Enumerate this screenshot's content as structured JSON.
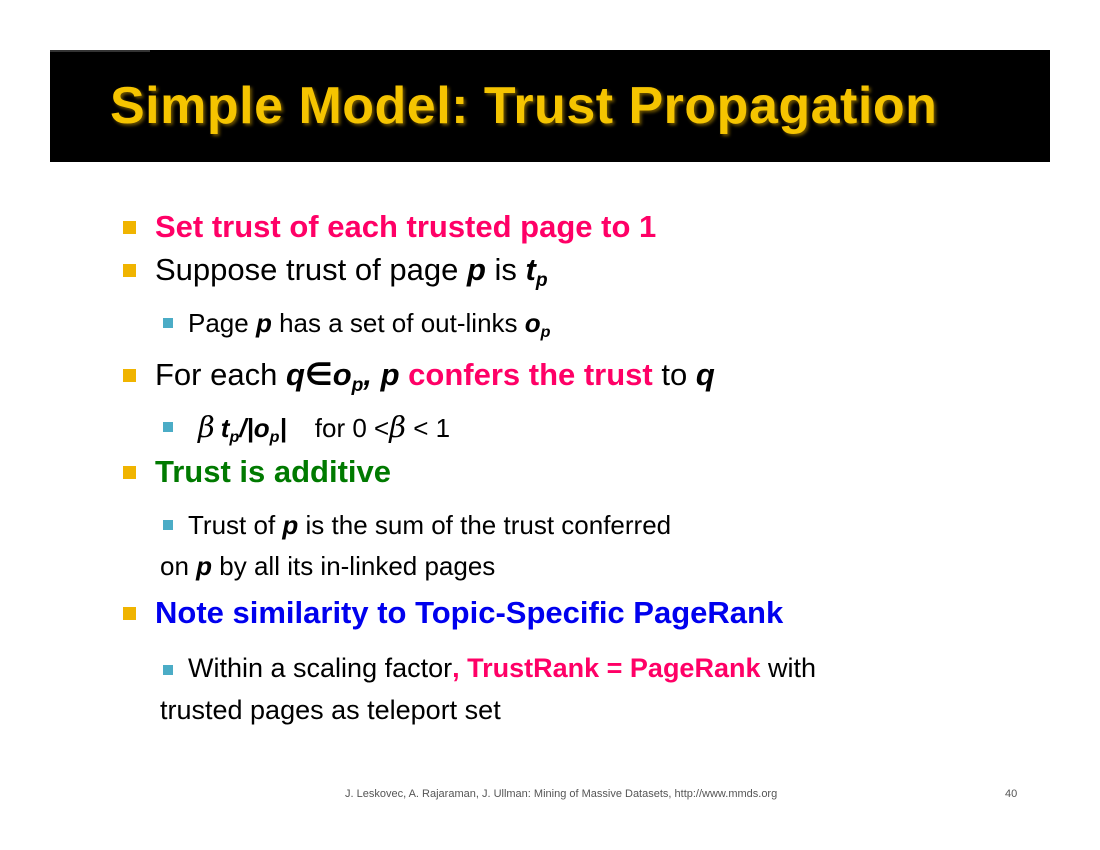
{
  "title": "Simple Model: Trust Propagation",
  "bullets": {
    "b1": "Set trust of each trusted page to 1",
    "b2_pre": "Suppose trust of page ",
    "b2_p": "p",
    "b2_is": " is ",
    "b2_t": "t",
    "b2_sub": "p",
    "b2a_pre": "Page ",
    "b2a_p": "p",
    "b2a_mid": " has a set of out-links ",
    "b2a_o": "o",
    "b2a_sub": "p",
    "b3_pre": "For each ",
    "b3_q": "q",
    "b3_in": "∈",
    "b3_o": "o",
    "b3_sub": "p",
    "b3_comma": ", ",
    "b3_p": "p",
    "b3_space": " ",
    "b3_red": "confers the trust",
    "b3_to": " to ",
    "b3_q2": "q",
    "b3a_beta": "β",
    "b3a_t": "t",
    "b3a_tsub": "p",
    "b3a_slash": "/|",
    "b3a_o": "o",
    "b3a_osub": "p",
    "b3a_bar": "|",
    "b3a_for": "for  0 <",
    "b3a_beta2": "β",
    "b3a_lt1": " < 1",
    "b4": "Trust is additive",
    "b4a_pre": "Trust of ",
    "b4a_p": "p",
    "b4a_post": " is the sum of the trust conferred",
    "b4b_pre": "on ",
    "b4b_p": "p",
    "b4b_post": " by all its in-linked pages",
    "b5": "Note similarity to Topic-Specific PageRank",
    "b5a_pre": "Within a scaling factor",
    "b5a_red": ", TrustRank = PageRank",
    "b5a_post": " with",
    "b5b": "trusted pages as teleport set"
  },
  "footer": {
    "citation": "J. Leskovec, A. Rajaraman, J. Ullman: Mining of Massive Datasets, http://www.mmds.org",
    "page_number": "40"
  },
  "colors": {
    "title": "#f5c400",
    "emphasis_red": "#ff0066",
    "emphasis_green": "#007a00",
    "emphasis_blue": "#0000ee",
    "bullet_l1": "#f0b400",
    "bullet_l2": "#4bacc6"
  }
}
